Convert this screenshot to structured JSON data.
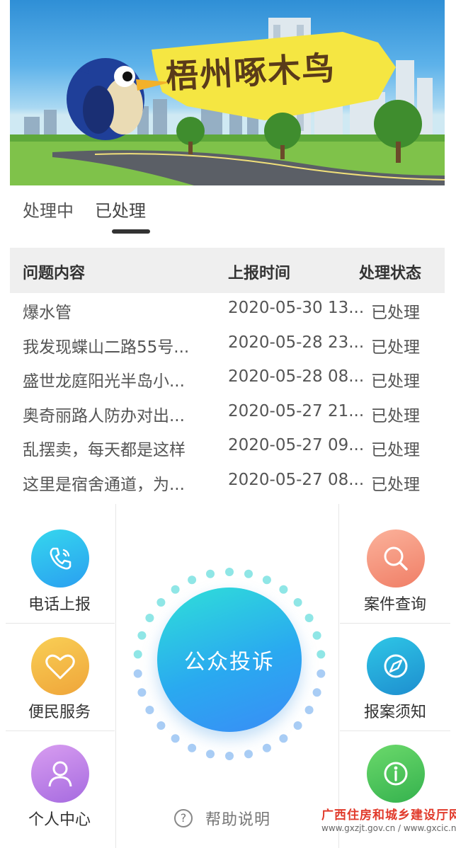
{
  "banner": {
    "title": "梧州啄木鸟"
  },
  "tabs": [
    {
      "label": "处理中"
    },
    {
      "label": "已处理"
    }
  ],
  "table": {
    "headers": [
      "问题内容",
      "上报时间",
      "处理状态"
    ],
    "rows": [
      {
        "content": "爆水管",
        "time": "2020-05-30 13...",
        "status": "已处理"
      },
      {
        "content": "我发现蝶山二路55号...",
        "time": "2020-05-28 23...",
        "status": "已处理"
      },
      {
        "content": "盛世龙庭阳光半岛小...",
        "time": "2020-05-28 08...",
        "status": "已处理"
      },
      {
        "content": "奥奇丽路人防办对出...",
        "time": "2020-05-27 21...",
        "status": "已处理"
      },
      {
        "content": "乱摆卖，每天都是这样",
        "time": "2020-05-27 09...",
        "status": "已处理"
      },
      {
        "content": "这里是宿舍通道，为...",
        "time": "2020-05-27 08...",
        "status": "已处理"
      }
    ]
  },
  "menu": {
    "phone_report": {
      "label": "电话上报",
      "icon": "phone-icon"
    },
    "convenience": {
      "label": "便民服务",
      "icon": "heart-icon"
    },
    "personal": {
      "label": "个人中心",
      "icon": "user-icon"
    },
    "case_query": {
      "label": "案件查询",
      "icon": "search-icon"
    },
    "report_notice": {
      "label": "报案须知",
      "icon": "compass-icon"
    },
    "info": {
      "label": "",
      "icon": "info-icon"
    },
    "complaint": {
      "label": "公众投诉"
    },
    "help": {
      "label": "帮助说明"
    }
  },
  "watermark": {
    "line1": "广西住房和城乡建设厅网",
    "line2": "www.gxzjt.gov.cn / www.gxcic.net"
  },
  "colors": {
    "phone": "#2ab6ee",
    "heart": "#f2b84a",
    "user": "#b77be8",
    "search": "#f58f7a",
    "compass": "#2aa6d8",
    "info": "#4cc466"
  }
}
